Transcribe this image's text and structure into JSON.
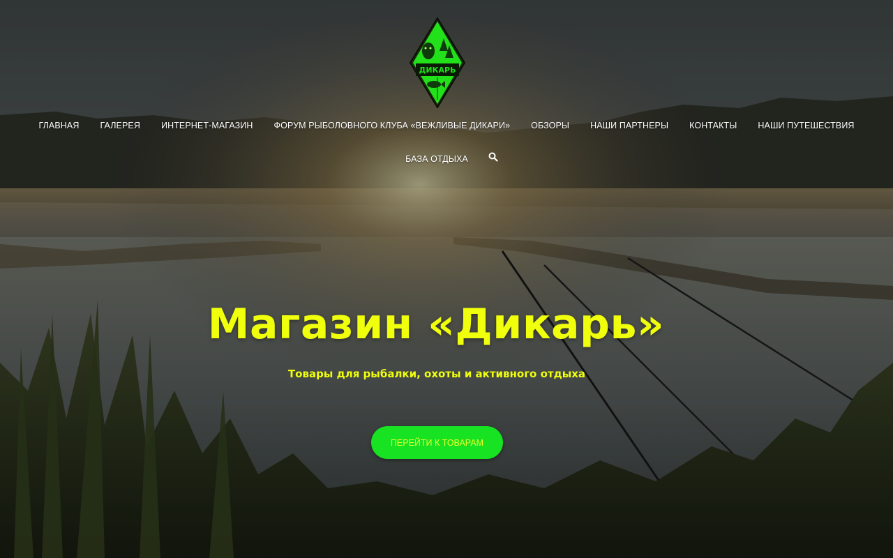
{
  "site": {
    "logo_text": "ДИКАРЬ"
  },
  "nav": {
    "items": [
      {
        "label": "ГЛАВНАЯ"
      },
      {
        "label": "ГАЛЕРЕЯ"
      },
      {
        "label": "ИНТЕРНЕТ-МАГАЗИН"
      },
      {
        "label": "ФОРУМ РЫБОЛОВНОГО КЛУБА «ВЕЖЛИВЫЕ ДИКАРИ»"
      },
      {
        "label": "ОБЗОРЫ"
      },
      {
        "label": "НАШИ ПАРТНЕРЫ"
      },
      {
        "label": "КОНТАКТЫ"
      },
      {
        "label": "НАШИ ПУТЕШЕСТВИЯ"
      },
      {
        "label": "БАЗА ОТДЫХА"
      }
    ],
    "search_icon": "search-icon"
  },
  "hero": {
    "title": "Магазин «Дикарь»",
    "subtitle": "Товары для рыбалки, охоты и активного отдыха",
    "cta_label": "ПЕРЕЙТИ К ТОВАРАМ"
  },
  "colors": {
    "accent_yellow": "#f0ff0c",
    "cta_green": "#17e322",
    "logo_green": "#22e01a"
  }
}
